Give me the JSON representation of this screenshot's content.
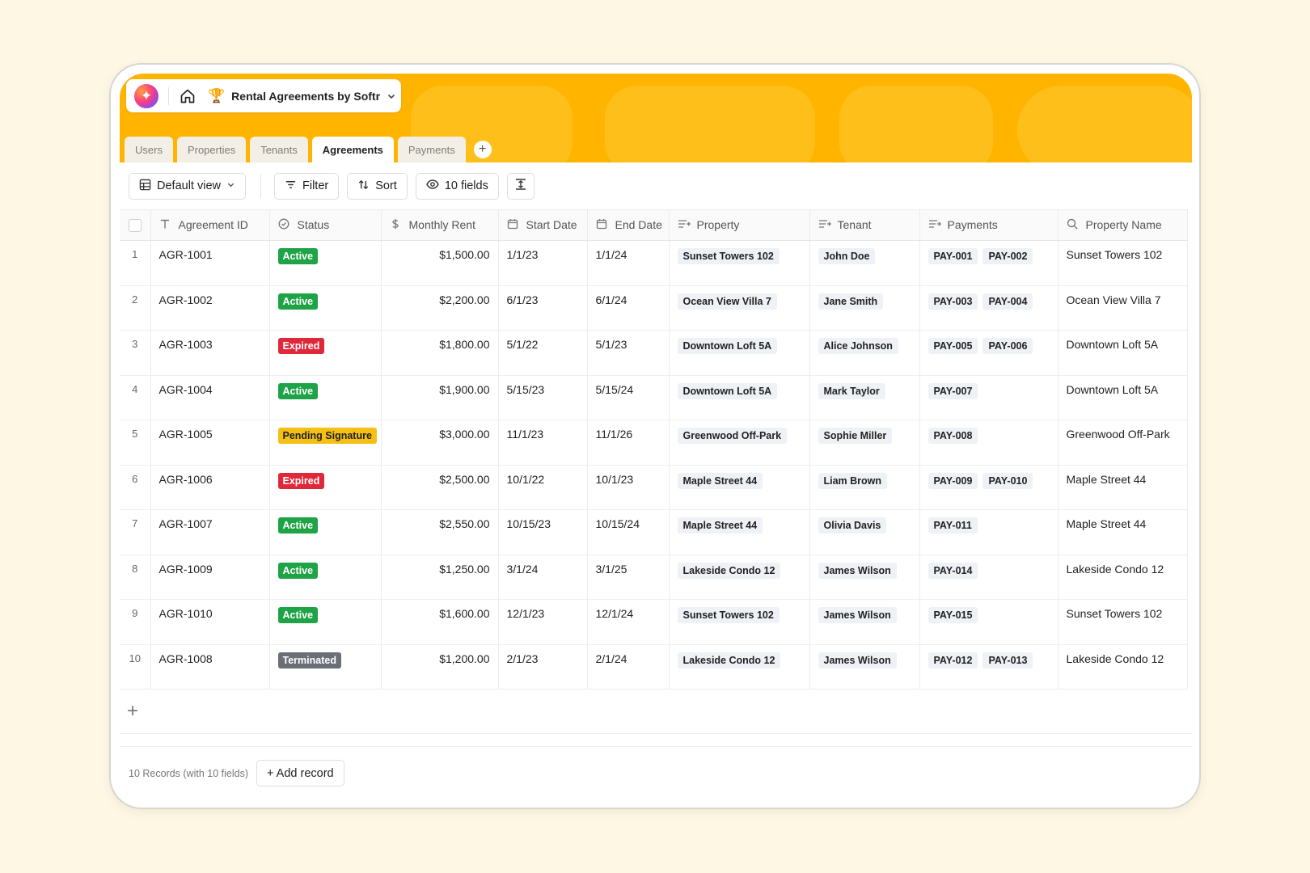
{
  "app": {
    "title": "Rental Agreements by Softr",
    "logo_glyph": "✦",
    "trophy_glyph": "🏆"
  },
  "tabs": [
    {
      "label": "Users",
      "active": false
    },
    {
      "label": "Properties",
      "active": false
    },
    {
      "label": "Tenants",
      "active": false
    },
    {
      "label": "Agreements",
      "active": true
    },
    {
      "label": "Payments",
      "active": false
    }
  ],
  "tab_add_glyph": "+",
  "toolbar": {
    "view_label": "Default view",
    "filter_label": "Filter",
    "sort_label": "Sort",
    "fields_label": "10 fields"
  },
  "columns": [
    {
      "key": "id",
      "label": "Agreement ID",
      "icon": "text-type-icon"
    },
    {
      "key": "status",
      "label": "Status",
      "icon": "status-circle-icon"
    },
    {
      "key": "rent",
      "label": "Monthly Rent",
      "icon": "dollar-icon"
    },
    {
      "key": "start",
      "label": "Start Date",
      "icon": "calendar-icon"
    },
    {
      "key": "end",
      "label": "End Date",
      "icon": "calendar-icon"
    },
    {
      "key": "property",
      "label": "Property",
      "icon": "linked-record-icon"
    },
    {
      "key": "tenant",
      "label": "Tenant",
      "icon": "linked-record-icon"
    },
    {
      "key": "payments",
      "label": "Payments",
      "icon": "linked-record-icon"
    },
    {
      "key": "property_name",
      "label": "Property Name",
      "icon": "lookup-search-icon"
    }
  ],
  "status_colors": {
    "Active": "#1ea446",
    "Expired": "#e0283b",
    "Pending Signature": "#f5c016",
    "Terminated": "#6b6f76"
  },
  "rows": [
    {
      "n": "1",
      "id": "AGR-1001",
      "status": "Active",
      "rent": "$1,500.00",
      "start": "1/1/23",
      "end": "1/1/24",
      "property": "Sunset Towers 102",
      "tenant": "John Doe",
      "payments": [
        "PAY-001",
        "PAY-002"
      ],
      "property_name": "Sunset Towers 102"
    },
    {
      "n": "2",
      "id": "AGR-1002",
      "status": "Active",
      "rent": "$2,200.00",
      "start": "6/1/23",
      "end": "6/1/24",
      "property": "Ocean View Villa 7",
      "tenant": "Jane Smith",
      "payments": [
        "PAY-003",
        "PAY-004"
      ],
      "property_name": "Ocean View Villa 7"
    },
    {
      "n": "3",
      "id": "AGR-1003",
      "status": "Expired",
      "rent": "$1,800.00",
      "start": "5/1/22",
      "end": "5/1/23",
      "property": "Downtown Loft 5A",
      "tenant": "Alice Johnson",
      "payments": [
        "PAY-005",
        "PAY-006"
      ],
      "property_name": "Downtown Loft 5A"
    },
    {
      "n": "4",
      "id": "AGR-1004",
      "status": "Active",
      "rent": "$1,900.00",
      "start": "5/15/23",
      "end": "5/15/24",
      "property": "Downtown Loft 5A",
      "tenant": "Mark Taylor",
      "payments": [
        "PAY-007"
      ],
      "property_name": "Downtown Loft 5A"
    },
    {
      "n": "5",
      "id": "AGR-1005",
      "status": "Pending Signature",
      "rent": "$3,000.00",
      "start": "11/1/23",
      "end": "11/1/26",
      "property": "Greenwood Off-Park",
      "tenant": "Sophie Miller",
      "payments": [
        "PAY-008"
      ],
      "property_name": "Greenwood Off-Park"
    },
    {
      "n": "6",
      "id": "AGR-1006",
      "status": "Expired",
      "rent": "$2,500.00",
      "start": "10/1/22",
      "end": "10/1/23",
      "property": "Maple Street 44",
      "tenant": "Liam Brown",
      "payments": [
        "PAY-009",
        "PAY-010"
      ],
      "property_name": "Maple Street 44"
    },
    {
      "n": "7",
      "id": "AGR-1007",
      "status": "Active",
      "rent": "$2,550.00",
      "start": "10/15/23",
      "end": "10/15/24",
      "property": "Maple Street 44",
      "tenant": "Olivia Davis",
      "payments": [
        "PAY-011"
      ],
      "property_name": "Maple Street 44"
    },
    {
      "n": "8",
      "id": "AGR-1009",
      "status": "Active",
      "rent": "$1,250.00",
      "start": "3/1/24",
      "end": "3/1/25",
      "property": "Lakeside Condo 12",
      "tenant": "James Wilson",
      "payments": [
        "PAY-014"
      ],
      "property_name": "Lakeside Condo 12"
    },
    {
      "n": "9",
      "id": "AGR-1010",
      "status": "Active",
      "rent": "$1,600.00",
      "start": "12/1/23",
      "end": "12/1/24",
      "property": "Sunset Towers 102",
      "tenant": "James Wilson",
      "payments": [
        "PAY-015"
      ],
      "property_name": "Sunset Towers 102"
    },
    {
      "n": "10",
      "id": "AGR-1008",
      "status": "Terminated",
      "rent": "$1,200.00",
      "start": "2/1/23",
      "end": "2/1/24",
      "property": "Lakeside Condo 12",
      "tenant": "James Wilson",
      "payments": [
        "PAY-012",
        "PAY-013"
      ],
      "property_name": "Lakeside Condo 12"
    }
  ],
  "add_row_glyph": "+",
  "footer": {
    "records_text": "10 Records (with 10 fields)",
    "add_record_label": "+ Add record"
  }
}
